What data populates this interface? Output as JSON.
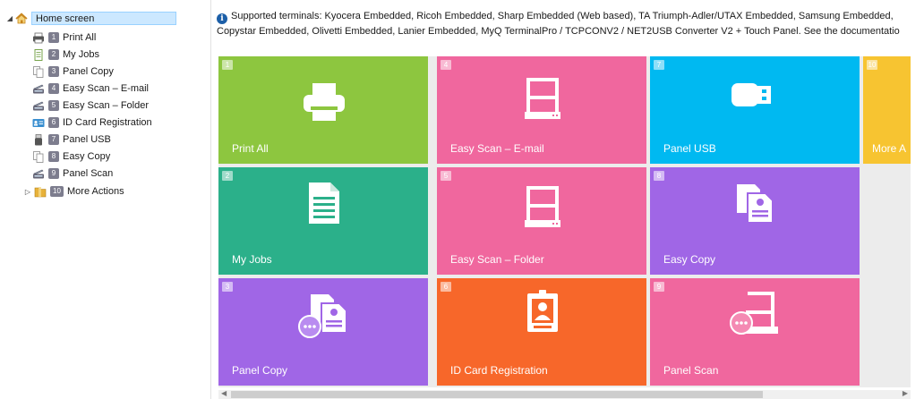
{
  "tree": {
    "root_label": "Home screen",
    "items": [
      {
        "number": "1",
        "label": "Print All",
        "icon": "printer-icon"
      },
      {
        "number": "2",
        "label": "My Jobs",
        "icon": "document-icon"
      },
      {
        "number": "3",
        "label": "Panel Copy",
        "icon": "copy-icon"
      },
      {
        "number": "4",
        "label": "Easy Scan – E-mail",
        "icon": "scanner-icon"
      },
      {
        "number": "5",
        "label": "Easy Scan – Folder",
        "icon": "scanner-icon"
      },
      {
        "number": "6",
        "label": "ID Card Registration",
        "icon": "id-card-icon"
      },
      {
        "number": "7",
        "label": "Panel USB",
        "icon": "usb-icon"
      },
      {
        "number": "8",
        "label": "Easy Copy",
        "icon": "copy-icon"
      },
      {
        "number": "9",
        "label": "Panel Scan",
        "icon": "scanner-icon"
      },
      {
        "number": "10",
        "label": "More Actions",
        "icon": "folder-icon"
      }
    ]
  },
  "info": {
    "line1": "Supported terminals: Kyocera Embedded, Ricoh Embedded, Sharp Embedded (Web based), TA Triumph-Adler/UTAX Embedded, Samsung Embedded,",
    "line2": "Copystar Embedded, Olivetti Embedded, Lanier Embedded, MyQ TerminalPro / TCPCONV2 / NET2USB Converter V2 + Touch Panel. See the documentatio"
  },
  "tiles": [
    {
      "number": "1",
      "label": "Print All",
      "color": "#8dc63f",
      "icon": "printer-icon"
    },
    {
      "number": "4",
      "label": "Easy Scan – E-mail",
      "color": "#f0679e",
      "icon": "scanner-icon"
    },
    {
      "number": "7",
      "label": "Panel USB",
      "color": "#00b9f1",
      "icon": "usb-icon"
    },
    {
      "number": "10",
      "label": "More A",
      "color": "#f7c431",
      "icon": "folder-icon"
    },
    {
      "number": "2",
      "label": "My Jobs",
      "color": "#2bb08a",
      "icon": "document-icon"
    },
    {
      "number": "5",
      "label": "Easy Scan – Folder",
      "color": "#f0679e",
      "icon": "scanner-icon"
    },
    {
      "number": "8",
      "label": "Easy Copy",
      "color": "#a066e6",
      "icon": "copy-icon"
    },
    {
      "number": "3",
      "label": "Panel Copy",
      "color": "#a066e6",
      "icon": "panel-copy-icon"
    },
    {
      "number": "6",
      "label": "ID Card Registration",
      "color": "#f7672a",
      "icon": "id-card-icon"
    },
    {
      "number": "9",
      "label": "Panel Scan",
      "color": "#f0679e",
      "icon": "panel-scan-icon"
    }
  ]
}
